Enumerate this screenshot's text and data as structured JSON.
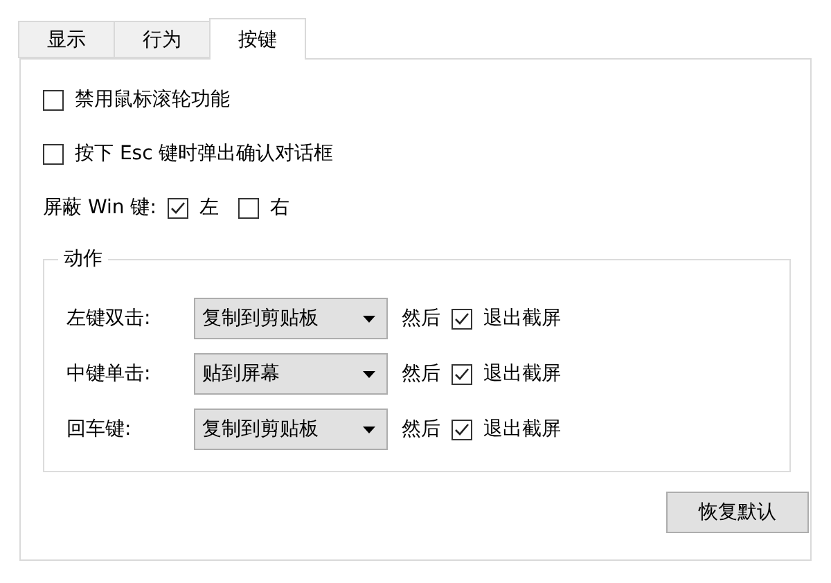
{
  "tabs": [
    {
      "label": "显示",
      "selected": false
    },
    {
      "label": "行为",
      "selected": false
    },
    {
      "label": "按键",
      "selected": true
    }
  ],
  "options": [
    {
      "label": "禁用鼠标滚轮功能",
      "checked": false
    },
    {
      "label": "按下 Esc 键时弹出确认对话框",
      "checked": false
    }
  ],
  "win_key": {
    "label": "屏蔽 Win 键:",
    "choices": [
      {
        "label": "左",
        "checked": true
      },
      {
        "label": "右",
        "checked": false
      }
    ]
  },
  "actions": {
    "title": "动作",
    "rows": [
      {
        "label": "左键双击:",
        "value": "复制到剪贴板",
        "then": "然后",
        "exit_label": "退出截屏",
        "exit_checked": true
      },
      {
        "label": "中键单击:",
        "value": "贴到屏幕",
        "then": "然后",
        "exit_label": "退出截屏",
        "exit_checked": true
      },
      {
        "label": "回车键:",
        "value": "复制到剪贴板",
        "then": "然后",
        "exit_label": "退出截屏",
        "exit_checked": true
      }
    ]
  },
  "reset_button": "恢复默认"
}
